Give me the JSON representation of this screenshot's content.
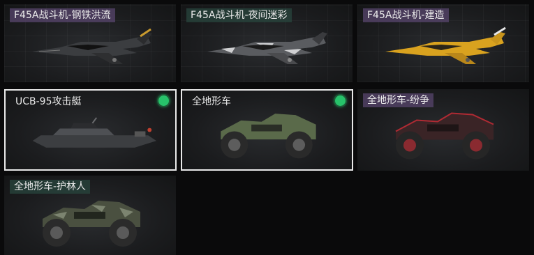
{
  "items": [
    {
      "label": "F45A战斗机-钢铁洪流",
      "kind": "jet",
      "scheme": "camo-dark",
      "selected": false,
      "equipped": false,
      "tint": "purple"
    },
    {
      "label": "F45A战斗机-夜间迷彩",
      "kind": "jet",
      "scheme": "camo-night",
      "selected": false,
      "equipped": false,
      "tint": "teal"
    },
    {
      "label": "F45A战斗机-建造",
      "kind": "jet",
      "scheme": "yellow",
      "selected": false,
      "equipped": false,
      "tint": "purple"
    },
    {
      "label": "UCB-95攻击艇",
      "kind": "boat",
      "scheme": "grey",
      "selected": true,
      "equipped": true,
      "tint": "plain"
    },
    {
      "label": "全地形车",
      "kind": "atv",
      "scheme": "green",
      "selected": true,
      "equipped": true,
      "tint": "plain"
    },
    {
      "label": "全地形车-纷争",
      "kind": "atv",
      "scheme": "red",
      "selected": false,
      "equipped": false,
      "tint": "purple"
    },
    {
      "label": "全地形车-护林人",
      "kind": "atv",
      "scheme": "forest",
      "selected": false,
      "equipped": false,
      "tint": "teal"
    }
  ],
  "colors": {
    "equipped_badge": "#27c26a",
    "selected_border": "#e9e9e9"
  }
}
